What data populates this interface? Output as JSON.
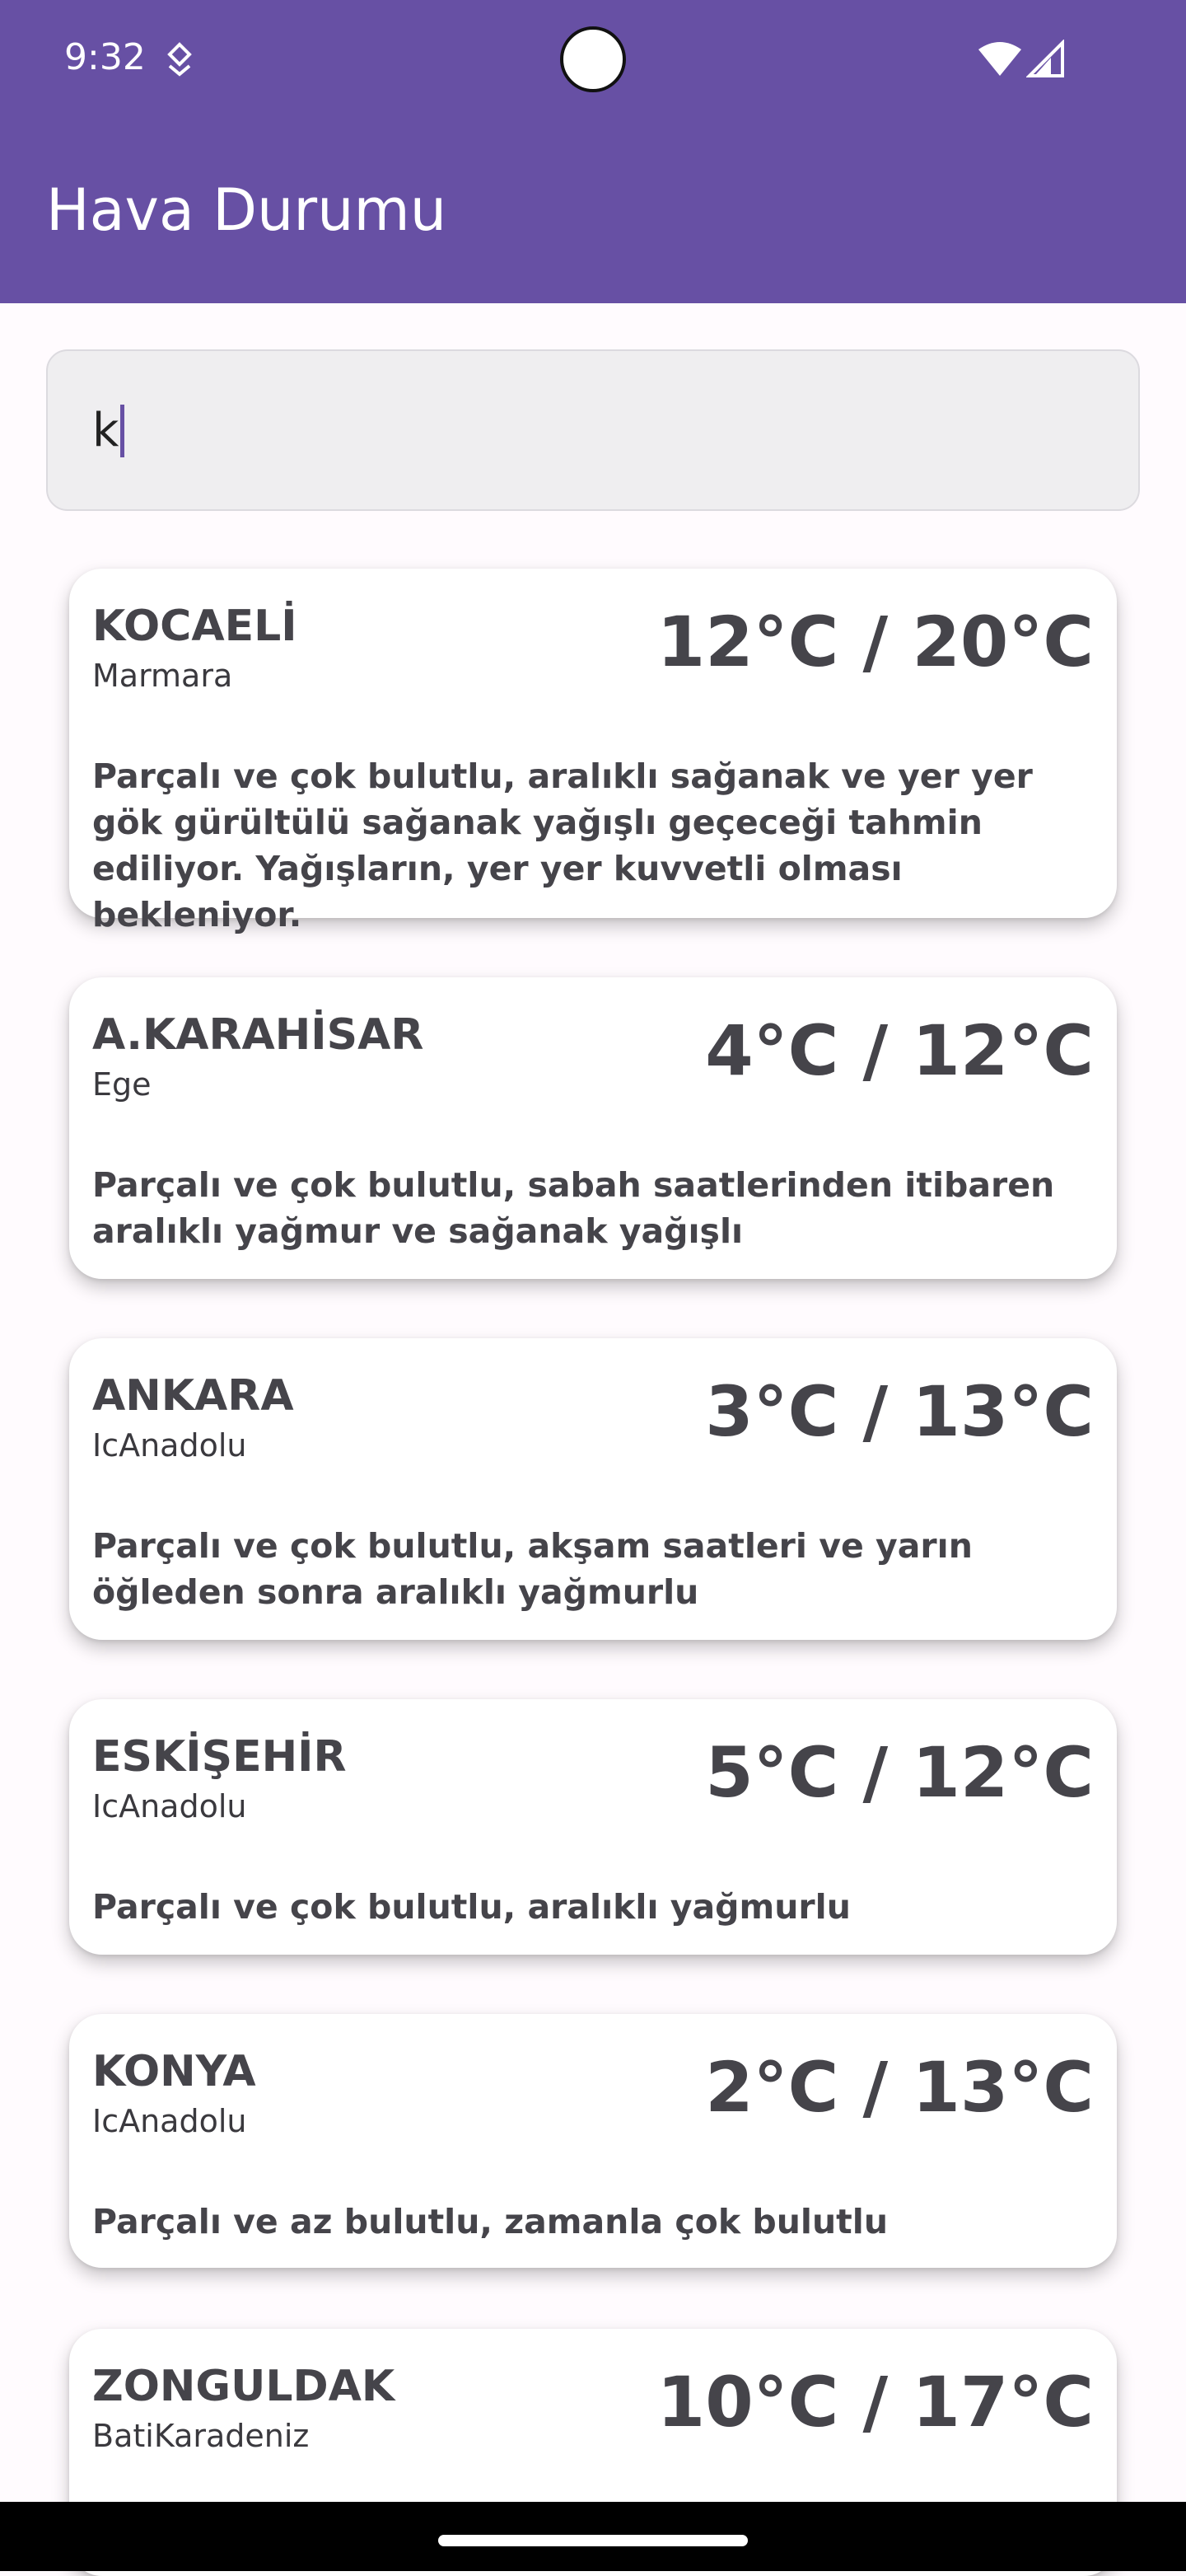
{
  "status_bar": {
    "time": "9:32",
    "icons": [
      "notification-icon",
      "wifi-icon",
      "signal-icon"
    ]
  },
  "app_bar": {
    "title": "Hava Durumu",
    "color": "#6750a4"
  },
  "search": {
    "value": "k"
  },
  "cards": [
    {
      "city": "KOCAELİ",
      "region": "Marmara",
      "temp": "12°C / 20°C",
      "description": "Parçalı ve çok bulutlu, aralıklı sağanak ve yer yer gök gürültülü sağanak yağışlı geçeceği tahmin ediliyor. Yağışların, yer yer kuvvetli olması bekleniyor."
    },
    {
      "city": "A.KARAHİSAR",
      "region": "Ege",
      "temp": "4°C / 12°C",
      "description": "Parçalı ve çok bulutlu, sabah saatlerinden itibaren aralıklı yağmur ve sağanak yağışlı"
    },
    {
      "city": "ANKARA",
      "region": "IcAnadolu",
      "temp": "3°C / 13°C",
      "description": "Parçalı ve çok bulutlu, akşam saatleri ve yarın öğleden sonra aralıklı yağmurlu"
    },
    {
      "city": "ESKİŞEHİR",
      "region": "IcAnadolu",
      "temp": "5°C / 12°C",
      "description": "Parçalı ve çok bulutlu, aralıklı yağmurlu"
    },
    {
      "city": "KONYA",
      "region": "IcAnadolu",
      "temp": "2°C / 13°C",
      "description": "Parçalı ve az bulutlu, zamanla çok bulutlu"
    },
    {
      "city": "ZONGULDAK",
      "region": "BatiKaradeniz",
      "temp": "10°C / 17°C",
      "description": ""
    }
  ]
}
